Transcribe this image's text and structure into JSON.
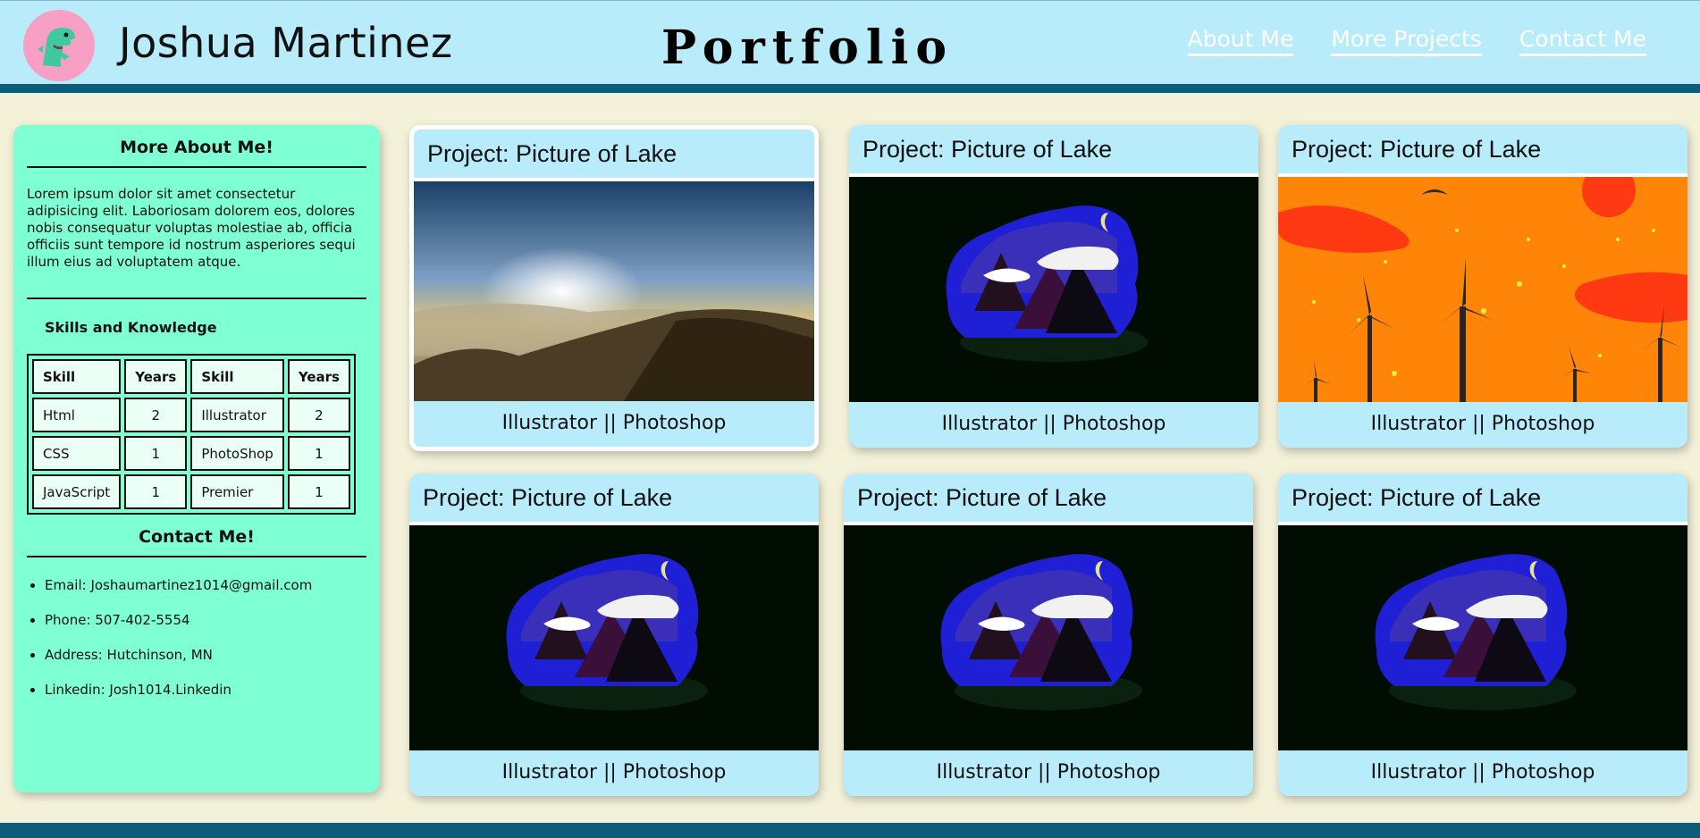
{
  "header": {
    "name": "Joshua Martinez",
    "title": "Portfolio",
    "nav": [
      "About Me",
      "More Projects",
      "Contact Me"
    ]
  },
  "sidebar": {
    "about_heading": "More About Me!",
    "about_text": "Lorem ipsum dolor sit amet consectetur adipisicing elit. Laboriosam dolorem eos, dolores nobis consequatur voluptas molestiae ab, officia officiis sunt tempore id nostrum asperiores sequi illum eius ad voluptatem atque.",
    "skills_heading": "Skills and Knowledge",
    "skills_headers": [
      "Skill",
      "Years",
      "Skill",
      "Years"
    ],
    "skills_rows": [
      [
        "Html",
        "2",
        "Illustrator",
        "2"
      ],
      [
        "CSS",
        "1",
        "PhotoShop",
        "1"
      ],
      [
        "JavaScript",
        "1",
        "Premier",
        "1"
      ]
    ],
    "contact_heading": "Contact Me!",
    "contact": [
      "Email: Joshaumartinez1014@gmail.com",
      "Phone: 507-402-5554",
      "Address: Hutchinson, MN",
      "Linkedin: Josh1014.Linkedin"
    ]
  },
  "projects": [
    {
      "title": "Project: Picture of Lake",
      "tools": "Illustrator || Photoshop",
      "image": "sunset-mountain"
    },
    {
      "title": "Project: Picture of Lake",
      "tools": "Illustrator || Photoshop",
      "image": "night-mountain"
    },
    {
      "title": "Project: Picture of Lake",
      "tools": "Illustrator || Photoshop",
      "image": "wind-turbines"
    },
    {
      "title": "Project: Picture of Lake",
      "tools": "Illustrator || Photoshop",
      "image": "night-mountain"
    },
    {
      "title": "Project: Picture of Lake",
      "tools": "Illustrator || Photoshop",
      "image": "night-mountain"
    },
    {
      "title": "Project: Picture of Lake",
      "tools": "Illustrator || Photoshop",
      "image": "night-mountain"
    }
  ],
  "colors": {
    "header_bg": "#b8ecfa",
    "accent_dark": "#0b5d7b",
    "sidebar_bg": "#7fffd4",
    "page_bg": "#f4f1d9"
  }
}
